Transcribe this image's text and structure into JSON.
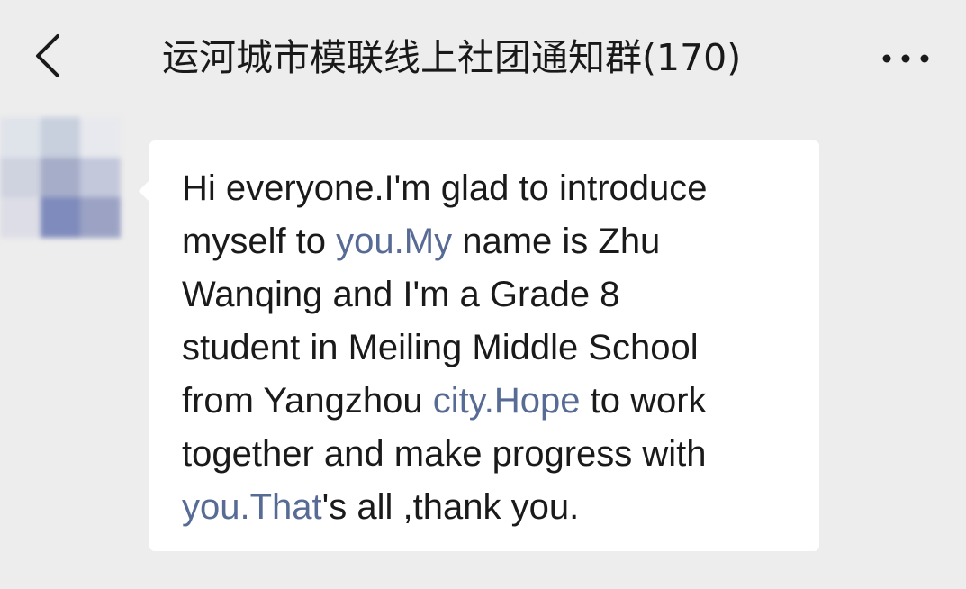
{
  "header": {
    "back_icon": "chevron-left-icon",
    "title": "运河城市模联线上社团通知群(170)",
    "more_icon": "more-horizontal-icon"
  },
  "avatar": {
    "blurred": true,
    "colors": [
      "#dfe3ea",
      "#c8d0de",
      "#e8e9ee",
      "#cfd2df",
      "#a6adc8",
      "#c3c8db",
      "#dcdde6",
      "#7f8bbd",
      "#9ba2c4"
    ]
  },
  "message": {
    "lines": [
      [
        {
          "text": "Hi everyone.I'm glad to introduce",
          "link": false
        }
      ],
      [
        {
          "text": "myself to ",
          "link": false
        },
        {
          "text": "you.My",
          "link": true
        },
        {
          "text": " name is Zhu",
          "link": false
        }
      ],
      [
        {
          "text": "Wanqing and I'm a Grade 8",
          "link": false
        }
      ],
      [
        {
          "text": "student in Meiling Middle School",
          "link": false
        }
      ],
      [
        {
          "text": "from Yangzhou ",
          "link": false
        },
        {
          "text": "city.Hope",
          "link": true
        },
        {
          "text": " to work",
          "link": false
        }
      ],
      [
        {
          "text": "together and make progress with",
          "link": false
        }
      ],
      [
        {
          "text": "you.That",
          "link": true
        },
        {
          "text": "'s all ,thank you.",
          "link": false
        }
      ]
    ]
  },
  "colors": {
    "background": "#ededed",
    "bubble": "#ffffff",
    "text": "#1a1a1a",
    "link": "#576b95"
  }
}
